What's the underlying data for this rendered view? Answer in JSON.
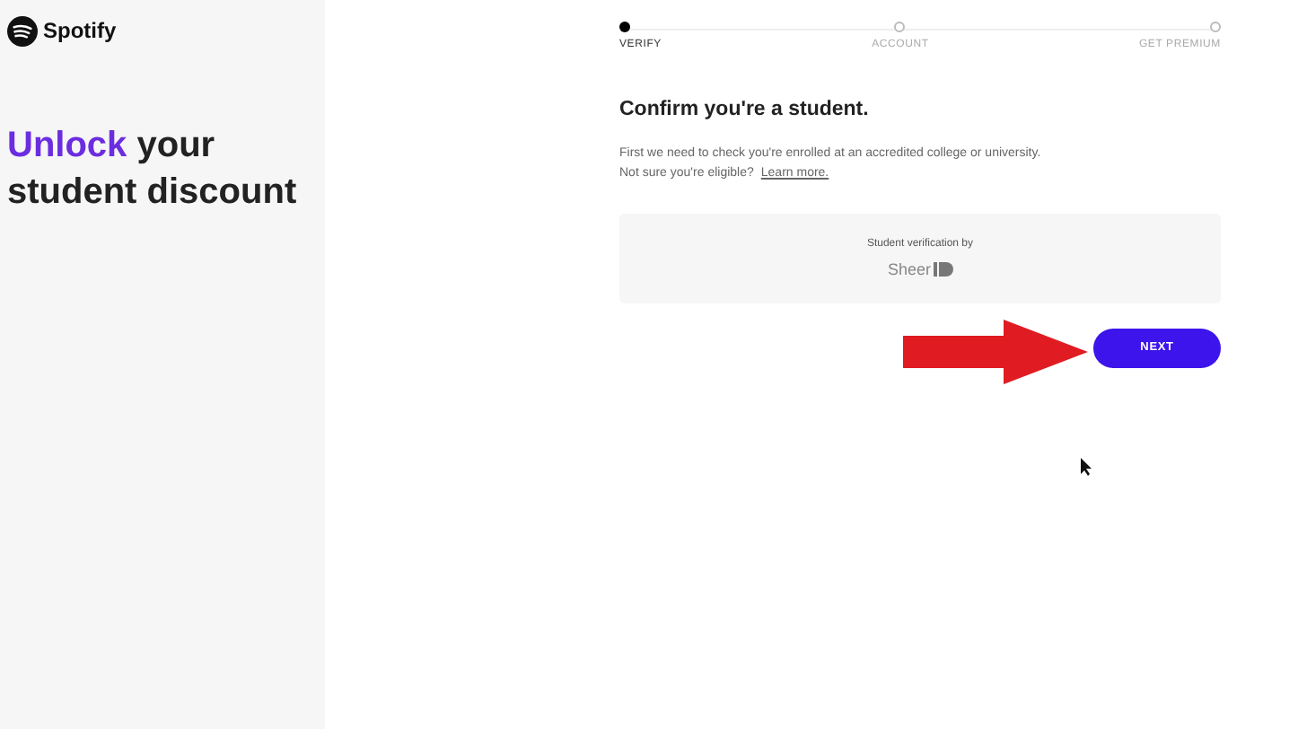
{
  "brand": {
    "name": "Spotify"
  },
  "headline": {
    "highlight": "Unlock",
    "rest": "your student discount"
  },
  "steps": [
    {
      "label": "VERIFY",
      "selected": true
    },
    {
      "label": "ACCOUNT",
      "selected": false
    },
    {
      "label": "GET PREMIUM",
      "selected": false
    }
  ],
  "title": "Confirm you're a student.",
  "description": "First we need to check you're enrolled at an accredited college or university.",
  "eligibility": {
    "text": "Not sure you're eligible?",
    "link": "Learn more."
  },
  "verification": {
    "caption": "Student verification by",
    "logo": "Sheer"
  },
  "next_button": "NEXT"
}
